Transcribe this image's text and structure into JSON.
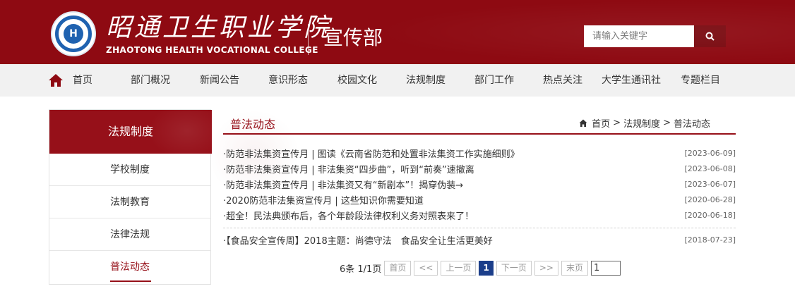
{
  "header": {
    "logo_text": "H",
    "college_cn": "昭通卫生职业学院",
    "college_en": "ZHAOTONG HEALTH VOCATIONAL COLLEGE",
    "department": "宣传部",
    "search_placeholder": "请输入关键字",
    "brand_color": "#8e0a12"
  },
  "nav": {
    "items": [
      {
        "label": "首页"
      },
      {
        "label": "部门概况"
      },
      {
        "label": "新闻公告"
      },
      {
        "label": "意识形态"
      },
      {
        "label": "校园文化"
      },
      {
        "label": "法规制度"
      },
      {
        "label": "部门工作"
      },
      {
        "label": "热点关注"
      },
      {
        "label": "大学生通讯社"
      },
      {
        "label": "专题栏目"
      }
    ]
  },
  "sidebar": {
    "title": "法规制度",
    "items": [
      {
        "label": "学校制度"
      },
      {
        "label": "法制教育"
      },
      {
        "label": "法律法规"
      },
      {
        "label": "普法动态",
        "active": true
      }
    ]
  },
  "main": {
    "title": "普法动态",
    "breadcrumb": [
      "首页",
      ">",
      "法规制度",
      ">",
      "普法动态"
    ],
    "news": [
      {
        "title": "·防范非法集资宣传月 | 图读《云南省防范和处置非法集资工作实施细则》",
        "date": "[2023-06-09]"
      },
      {
        "title": "·防范非法集资宣传月 | 非法集资“四步曲”，听到“前奏”速撤离",
        "date": "[2023-06-08]"
      },
      {
        "title": "·防范非法集资宣传月 | 非法集资又有“新剧本”！揭穿伪装→",
        "date": "[2023-06-07]"
      },
      {
        "title": "·2020防范非法集资宣传月 | 这些知识你需要知道",
        "date": "[2020-06-28]"
      },
      {
        "title": "·超全！民法典颁布后，各个年龄段法律权利义务对照表来了！",
        "date": "[2020-06-18]"
      },
      {
        "title": "·【食品安全宣传周】2018主题：尚德守法　食品安全让生活更美好",
        "date": "[2018-07-23]"
      }
    ]
  },
  "pager": {
    "summary": "6条 1/1页",
    "first": "首页",
    "prev_jump": "<<",
    "prev": "上一页",
    "current": "1",
    "next": "下一页",
    "next_jump": ">>",
    "last": "末页",
    "goto_value": "1"
  }
}
